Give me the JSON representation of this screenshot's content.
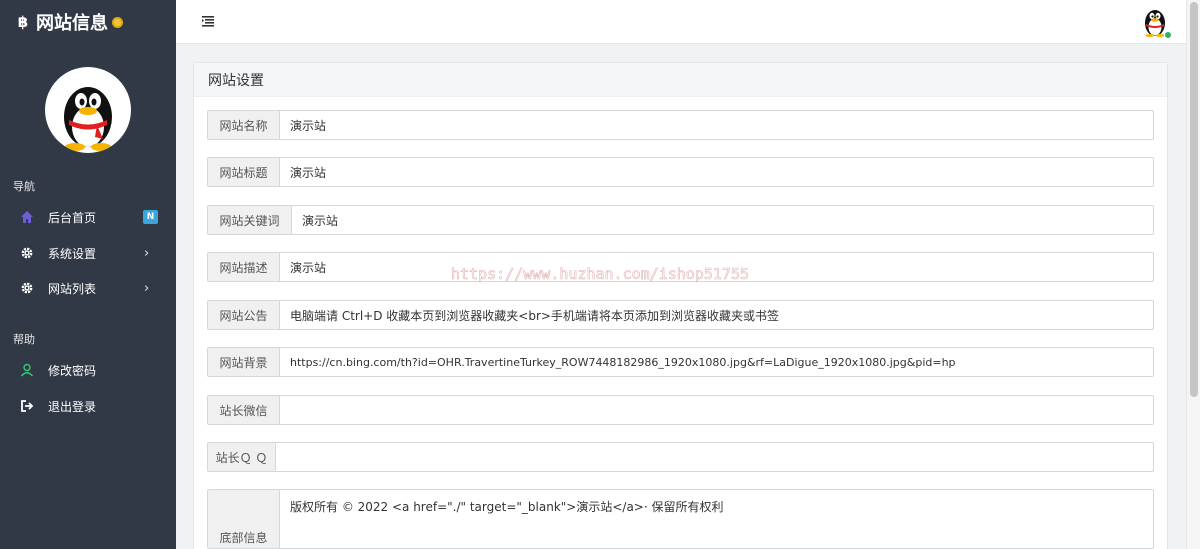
{
  "sidebar": {
    "brand": {
      "icon": "฿",
      "title": "网站信息"
    },
    "nav_header": "导航",
    "nav_items": [
      {
        "label": "后台首页",
        "icon": "home-icon",
        "badge": "N"
      },
      {
        "label": "系统设置",
        "icon": "gear-icon",
        "chevron": "›"
      },
      {
        "label": "网站列表",
        "icon": "gear-icon",
        "chevron": "›"
      }
    ],
    "help_header": "帮助",
    "help_items": [
      {
        "label": "修改密码",
        "icon": "user-icon"
      },
      {
        "label": "退出登录",
        "icon": "logout-icon"
      }
    ]
  },
  "panel": {
    "title": "网站设置",
    "fields": [
      {
        "label": "网站名称",
        "value": "演示站"
      },
      {
        "label": "网站标题",
        "value": "演示站"
      },
      {
        "label": "网站关键词",
        "value": "演示站"
      },
      {
        "label": "网站描述",
        "value": "演示站"
      },
      {
        "label": "网站公告",
        "value": "电脑端请 Ctrl+D 收藏本页到浏览器收藏夹<br>手机端请将本页添加到浏览器收藏夹或书签"
      },
      {
        "label": "网站背景",
        "value": "https://cn.bing.com/th?id=OHR.TravertineTurkey_ROW7448182986_1920x1080.jpg&rf=LaDigue_1920x1080.jpg&pid=hp"
      },
      {
        "label": "站长微信",
        "value": ""
      },
      {
        "label": "站长Ｑ Ｑ",
        "value": ""
      },
      {
        "label": "底部信息",
        "value": "版权所有 © 2022 <a href=\"./\" target=\"_blank\">演示站</a>· 保留所有权利"
      }
    ]
  },
  "watermark": "https://www.huzhan.com/ishop51755",
  "colors": {
    "sidebar_bg": "#323946",
    "accent": "#3aa7dc",
    "online": "#28b463"
  }
}
